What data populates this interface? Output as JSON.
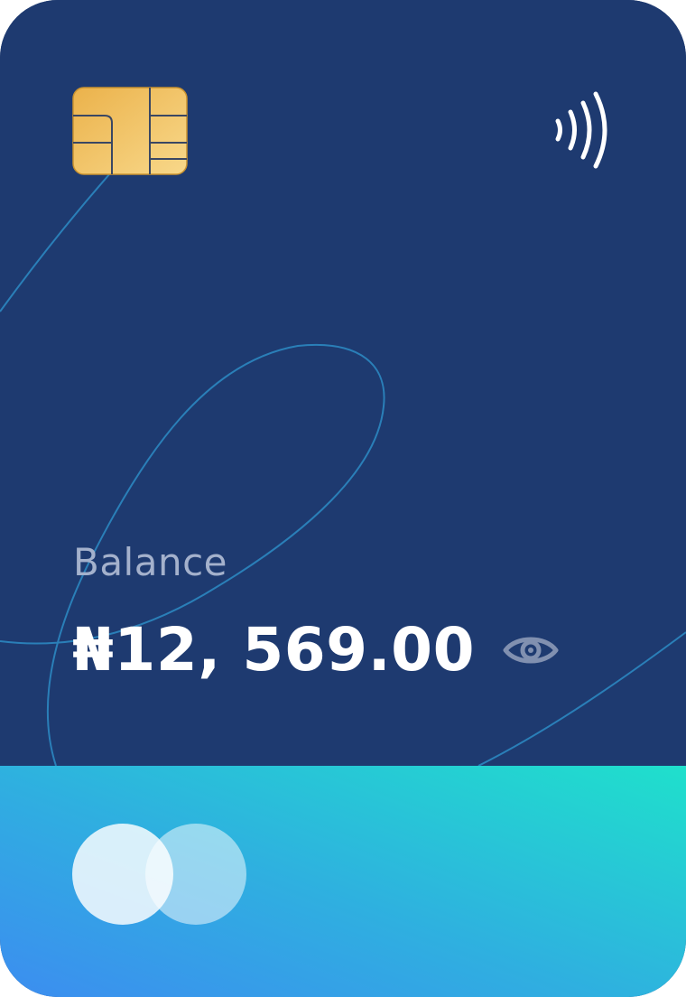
{
  "card": {
    "balance_label": "Balance",
    "balance_amount": "₦12, 569.00",
    "colors": {
      "card_background": "#1e3a70",
      "stripe_gradient_start": "#3c8df0",
      "stripe_gradient_end": "#1fe0cc",
      "chip_gold": "#ecb95a",
      "balance_label": "#a4b1cc",
      "balance_amount": "#ffffff",
      "decor_line": "#2a7fb8"
    },
    "icons": {
      "chip": "card-chip-icon",
      "contactless": "contactless-icon",
      "visibility": "eye-icon",
      "brand": "card-brand-logo"
    }
  }
}
